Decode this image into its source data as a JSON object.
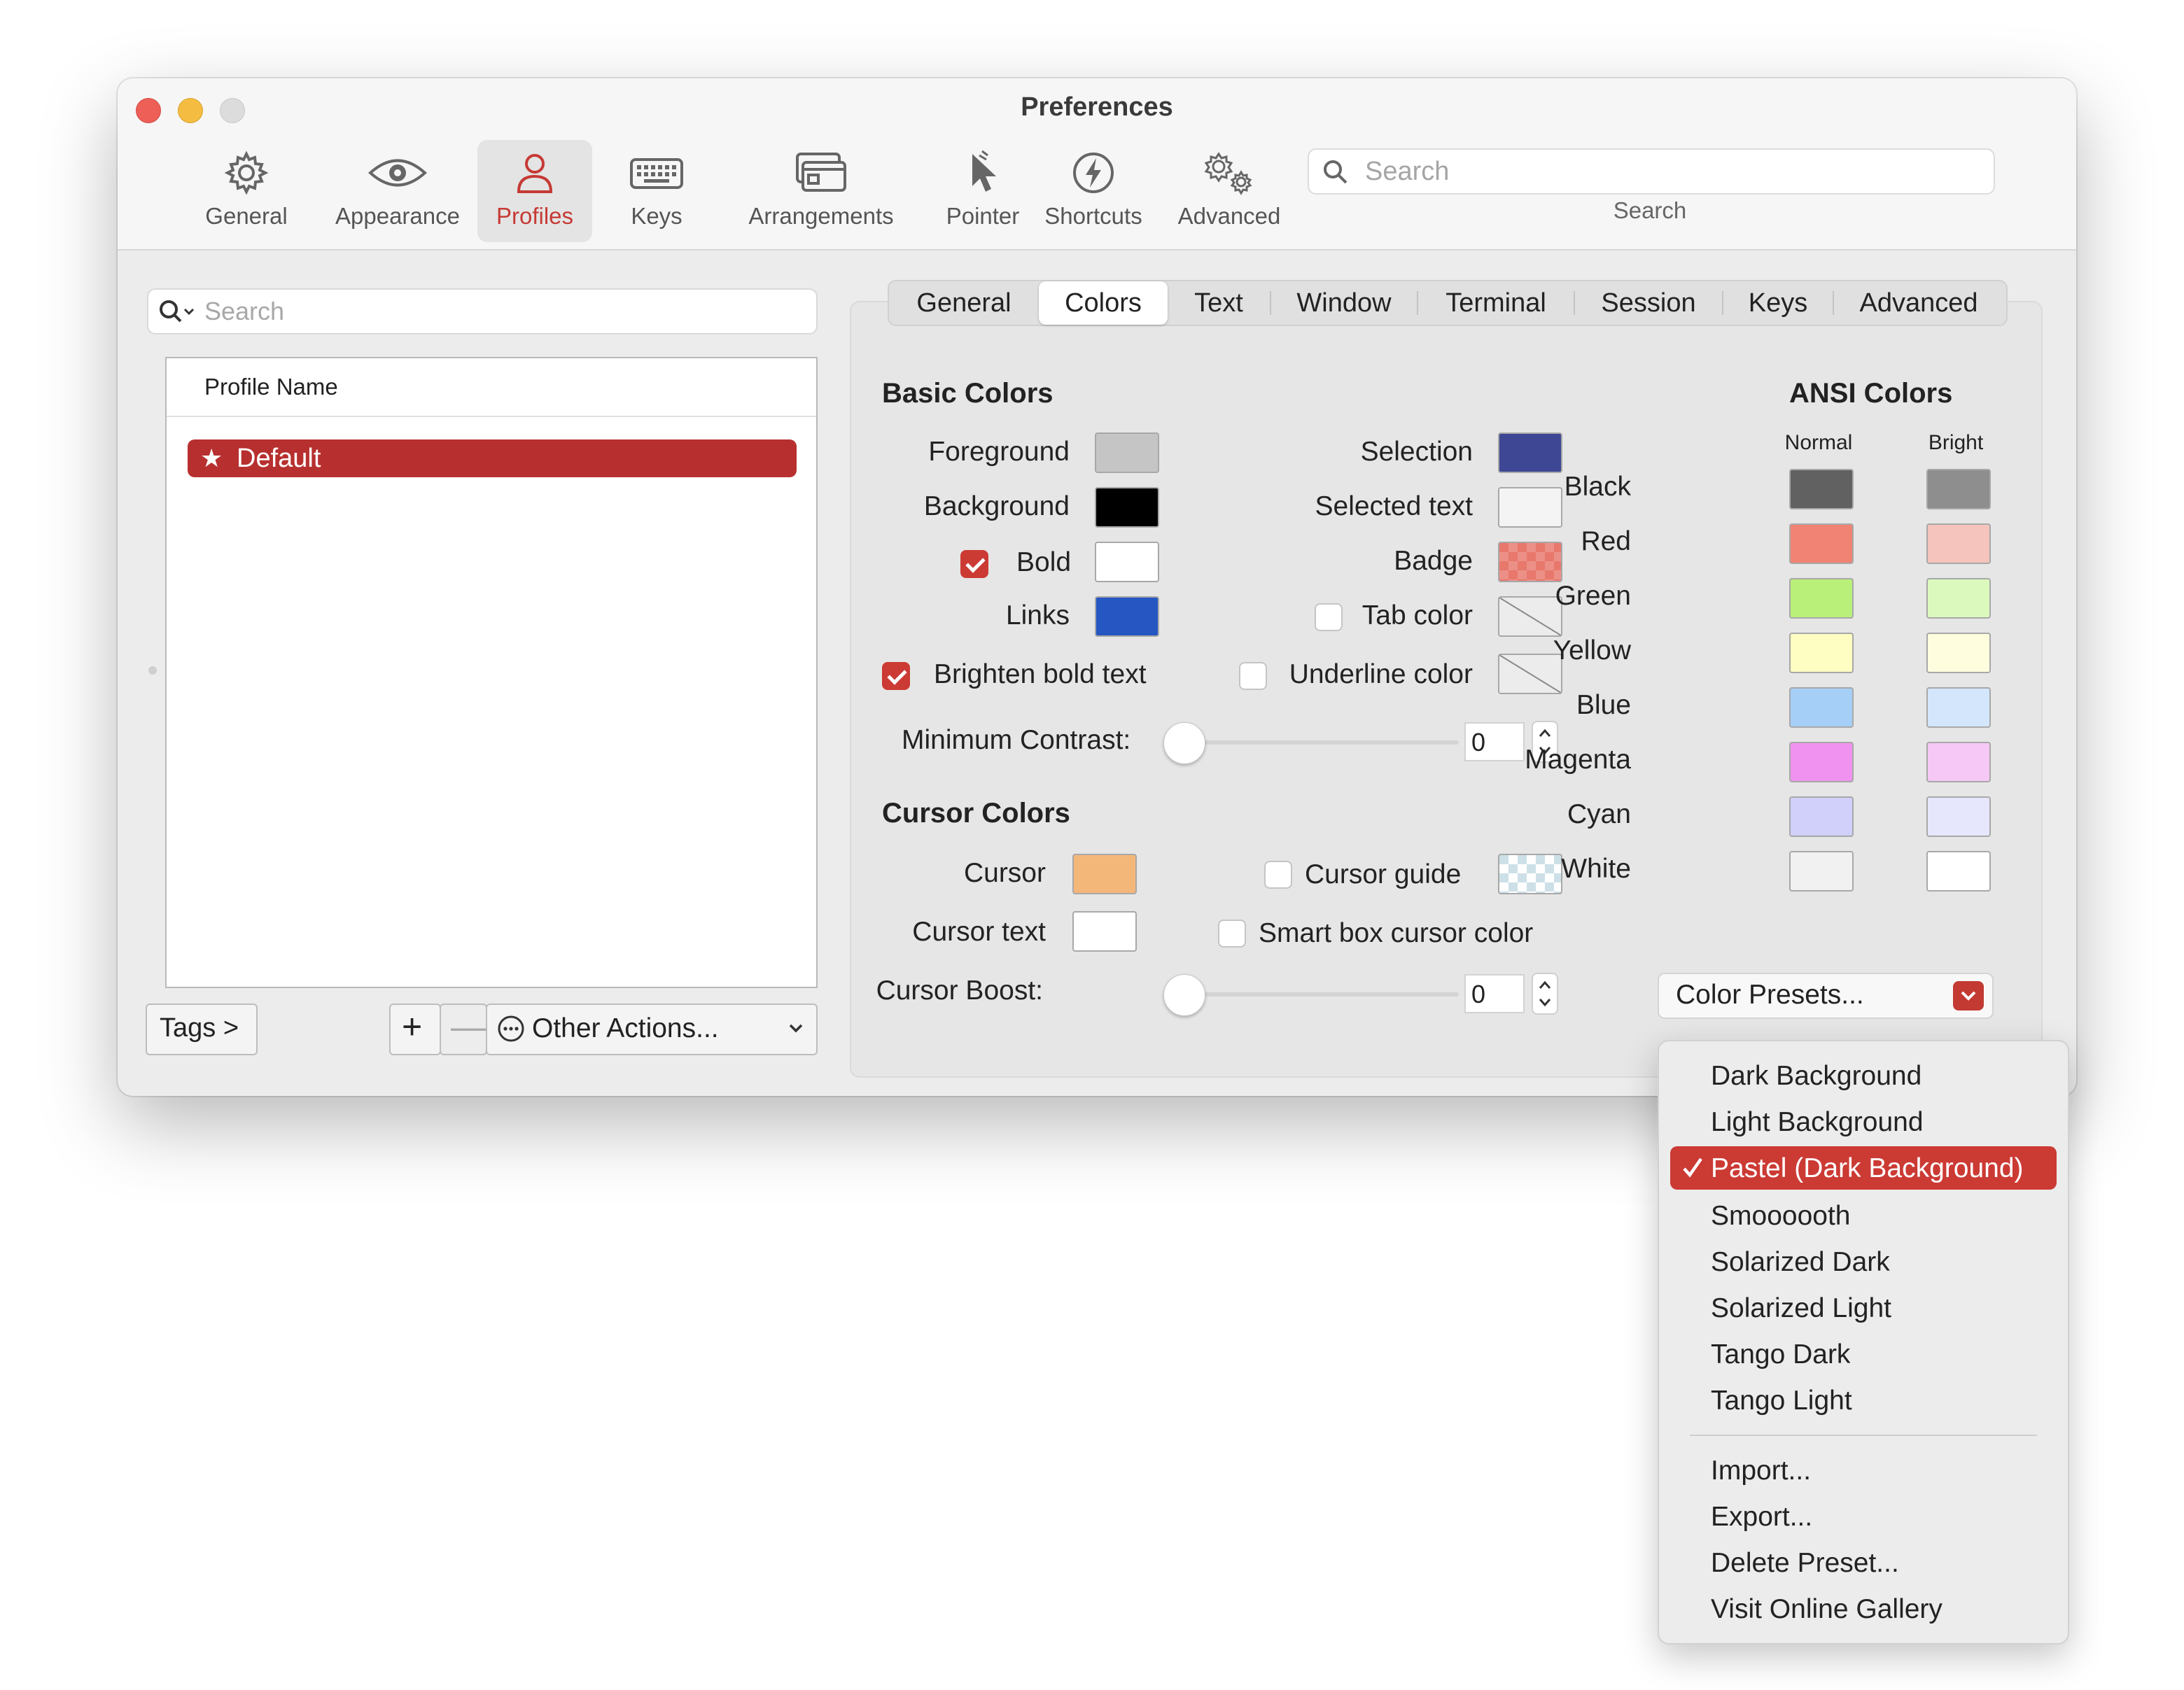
{
  "window": {
    "title": "Preferences"
  },
  "toolbar": {
    "items": [
      {
        "label": "General",
        "icon": "gear-icon"
      },
      {
        "label": "Appearance",
        "icon": "eye-icon"
      },
      {
        "label": "Profiles",
        "icon": "person-icon"
      },
      {
        "label": "Keys",
        "icon": "keyboard-icon"
      },
      {
        "label": "Arrangements",
        "icon": "windows-icon"
      },
      {
        "label": "Pointer",
        "icon": "pointer-icon"
      },
      {
        "label": "Shortcuts",
        "icon": "bolt-icon"
      },
      {
        "label": "Advanced",
        "icon": "gears-icon"
      }
    ],
    "active": "Profiles",
    "search": {
      "placeholder": "Search",
      "caption": "Search"
    }
  },
  "profiles": {
    "search_placeholder": "Search",
    "column_header": "Profile Name",
    "rows": [
      {
        "name": "Default",
        "default": true
      }
    ],
    "tags_button": "Tags >",
    "add_button": "+",
    "remove_button": "—",
    "actions_button": "Other Actions..."
  },
  "tabs": {
    "items": [
      "General",
      "Colors",
      "Text",
      "Window",
      "Terminal",
      "Session",
      "Keys",
      "Advanced"
    ],
    "active": "Colors"
  },
  "basic_colors": {
    "heading": "Basic Colors",
    "foreground": {
      "label": "Foreground",
      "color": "#c5c5c5"
    },
    "background": {
      "label": "Background",
      "color": "#000000"
    },
    "bold": {
      "label": "Bold",
      "color": "#ffffff",
      "checked": true
    },
    "links": {
      "label": "Links",
      "color": "#2556c2"
    },
    "brighten_bold": {
      "label": "Brighten bold text",
      "checked": true
    },
    "selection": {
      "label": "Selection",
      "color": "#3d4793"
    },
    "selected_text": {
      "label": "Selected text",
      "color": "#f4f4f4"
    },
    "badge": {
      "label": "Badge",
      "color": "#e8786c"
    },
    "tab_color": {
      "label": "Tab color",
      "checked": false
    },
    "underline_color": {
      "label": "Underline color",
      "checked": false
    },
    "min_contrast": {
      "label": "Minimum Contrast:",
      "value": "0"
    }
  },
  "cursor_colors": {
    "heading": "Cursor Colors",
    "cursor": {
      "label": "Cursor",
      "color": "#f4b77a"
    },
    "cursor_text": {
      "label": "Cursor text",
      "color": "#ffffff"
    },
    "cursor_guide": {
      "label": "Cursor guide",
      "checked": false
    },
    "smart_box": {
      "label": "Smart box cursor color",
      "checked": false
    },
    "cursor_boost": {
      "label": "Cursor Boost:",
      "value": "0"
    }
  },
  "ansi": {
    "heading": "ANSI Colors",
    "normal_label": "Normal",
    "bright_label": "Bright",
    "rows": [
      {
        "name": "Black",
        "normal": "#616161",
        "bright": "#8e8e8e"
      },
      {
        "name": "Red",
        "normal": "#f08374",
        "bright": "#f5c4bd"
      },
      {
        "name": "Green",
        "normal": "#b8f07a",
        "bright": "#dcf9bd"
      },
      {
        "name": "Yellow",
        "normal": "#fefdc2",
        "bright": "#fefedf"
      },
      {
        "name": "Blue",
        "normal": "#a6cff8",
        "bright": "#d3e6fb"
      },
      {
        "name": "Magenta",
        "normal": "#f093f0",
        "bright": "#f6c8f6"
      },
      {
        "name": "Cyan",
        "normal": "#d0d0fa",
        "bright": "#e6e6fc"
      },
      {
        "name": "White",
        "normal": "#f1f1f1",
        "bright": "#ffffff"
      }
    ]
  },
  "presets": {
    "button_label": "Color Presets...",
    "menu": {
      "items": [
        "Dark Background",
        "Light Background",
        "Pastel (Dark Background)",
        "Smoooooth",
        "Solarized Dark",
        "Solarized Light",
        "Tango Dark",
        "Tango Light"
      ],
      "selected": "Pastel (Dark Background)",
      "actions": [
        "Import...",
        "Export...",
        "Delete Preset...",
        "Visit Online Gallery"
      ]
    }
  },
  "accent_color": "#cc3a34"
}
